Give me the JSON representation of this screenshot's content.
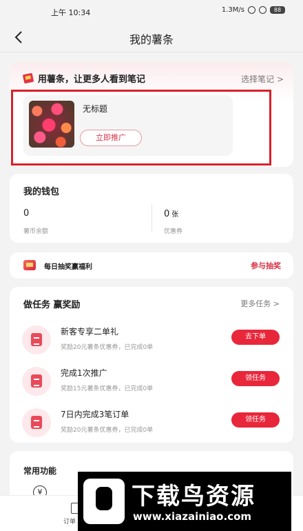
{
  "status_bar": {
    "time": "上午 10:34",
    "speed": "1.3M/s",
    "battery": "88"
  },
  "nav": {
    "title": "我的薯条"
  },
  "promo": {
    "heading": "用薯条，让更多人看到笔记",
    "choose_label": "选择笔记 >",
    "note_title": "无标题",
    "promote_button": "立即推广"
  },
  "wallet": {
    "heading": "我的钱包",
    "coin_value": "0",
    "coin_label": "薯币余额",
    "coupon_value": "0",
    "coupon_unit": "张",
    "coupon_label": "优惠券"
  },
  "lottery": {
    "text": "每日抽奖赢福利",
    "action": "参与抽奖"
  },
  "tasks": {
    "heading": "做任务 赢奖励",
    "more_label": "更多任务 >",
    "items": [
      {
        "title": "新客专享二单礼",
        "desc": "奖励20元薯条优惠券，已完成0单",
        "button": "去下单"
      },
      {
        "title": "完成1次推广",
        "desc": "奖励15元薯条优惠券，已完成0单",
        "button": "领任务"
      },
      {
        "title": "7日内完成3笔订单",
        "desc": "奖励20元薯条优惠券，已完成0单",
        "button": "领任务"
      }
    ]
  },
  "common": {
    "heading": "常用功能",
    "yen_symbol": "¥"
  },
  "tabbar": {
    "orders_label": "订单"
  },
  "watermark": {
    "brand": "下载鸟资源",
    "url": "www.xiazainiao.com"
  },
  "colors": {
    "accent": "#e8273b",
    "highlight_box": "#d8202a"
  }
}
